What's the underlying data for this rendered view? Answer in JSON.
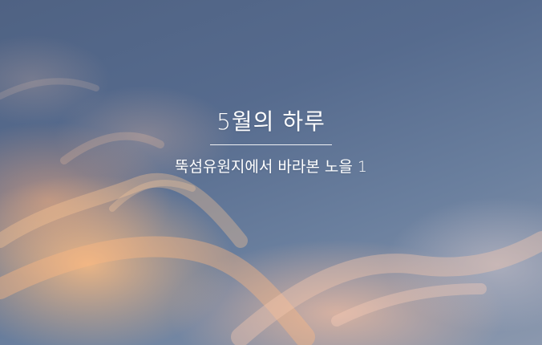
{
  "hero": {
    "title": "5월의 하루",
    "subtitle": "뚝섬유원지에서 바라본 노을 1"
  },
  "colors": {
    "sky_blue": "#566b8e",
    "sunset_orange": "#ffbe82",
    "text": "#ffffff"
  }
}
